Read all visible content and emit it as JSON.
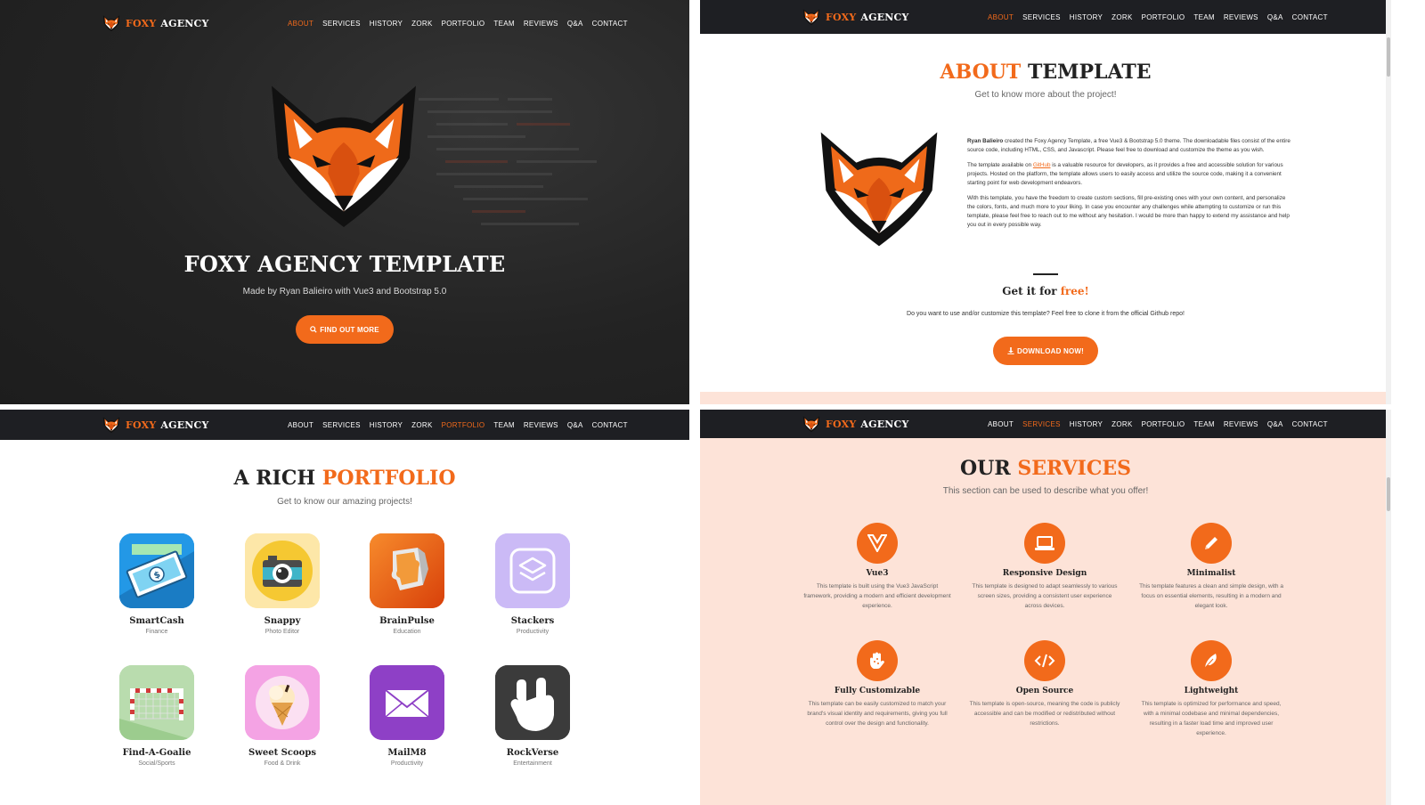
{
  "brand": {
    "part1": "FOXY",
    "part2": "AGENCY"
  },
  "nav": [
    "ABOUT",
    "SERVICES",
    "HISTORY",
    "ZORK",
    "PORTFOLIO",
    "TEAM",
    "REVIEWS",
    "Q&A",
    "CONTACT"
  ],
  "colors": {
    "accent": "#f26a1b",
    "dark": "#1e1f23",
    "peach": "#fde3d8"
  },
  "hero": {
    "title": "FOXY AGENCY TEMPLATE",
    "subtitle": "Made by Ryan Balieiro with Vue3 and Bootstrap 5.0",
    "button": "FIND OUT MORE",
    "button_icon": "search-icon"
  },
  "about": {
    "title_hl": "ABOUT",
    "title_rest": "TEMPLATE",
    "subtitle": "Get to know more about the project!",
    "p1_author": "Ryan Balieiro",
    "p1_rest": "created the Foxy Agency Template, a free Vue3 & Bootstrap 5.0 theme. The downloadable files consist of the entire source code, including HTML, CSS, and Javascript. Please feel free to download and customize the theme as you wish.",
    "p2_pre": "The template available on",
    "p2_link": "GitHub",
    "p2_post": "is a valuable resource for developers, as it provides a free and accessible solution for various projects. Hosted on the platform, the template allows users to easily access and utilize the source code, making it a convenient starting point for web development endeavors.",
    "p3": "With this template, you have the freedom to create custom sections, fill pre-existing ones with your own content, and personalize the colors, fonts, and much more to your liking. In case you encounter any challenges while attempting to customize or run this template, please feel free to reach out to me without any hesitation. I would be more than happy to extend my assistance and help you out in every possible way.",
    "free_title": "Get it for",
    "free_hl": "free!",
    "free_sub": "Do you want to use and/or customize this template? Feel free to clone it from the official Github repo!",
    "button": "DOWNLOAD NOW!",
    "button_icon": "download-icon"
  },
  "portfolio": {
    "title_rest": "A RICH",
    "title_hl": "PORTFOLIO",
    "subtitle": "Get to know our amazing projects!",
    "items": [
      {
        "name": "SmartCash",
        "category": "Finance",
        "icon": "money-icon",
        "bg": "#1e8fe0"
      },
      {
        "name": "Snappy",
        "category": "Photo Editor",
        "icon": "camera-icon",
        "bg": "#fde7a8"
      },
      {
        "name": "BrainPulse",
        "category": "Education",
        "icon": "puzzle-icon",
        "bg": "#ee5a12"
      },
      {
        "name": "Stackers",
        "category": "Productivity",
        "icon": "stack-icon",
        "bg": "#c9b8f5"
      },
      {
        "name": "Find-A-Goalie",
        "category": "Social/Sports",
        "icon": "goal-icon",
        "bg": "#b5dbab"
      },
      {
        "name": "Sweet Scoops",
        "category": "Food & Drink",
        "icon": "ice-cream-icon",
        "bg": "#f6a6e6"
      },
      {
        "name": "MailM8",
        "category": "Productivity",
        "icon": "mail-icon",
        "bg": "#8d3fc4"
      },
      {
        "name": "RockVerse",
        "category": "Entertainment",
        "icon": "rock-hand-icon",
        "bg": "#3a3a3a"
      }
    ]
  },
  "services": {
    "title_rest": "OUR",
    "title_hl": "SERVICES",
    "subtitle": "This section can be used to describe what you offer!",
    "items": [
      {
        "name": "Vue3",
        "icon": "vue-icon",
        "desc": "This template is built using the Vue3 JavaScript framework, providing a modern and efficient development experience."
      },
      {
        "name": "Responsive Design",
        "icon": "laptop-icon",
        "desc": "This template is designed to adapt seamlessly to various screen sizes, providing a consistent user experience across devices."
      },
      {
        "name": "Minimalist",
        "icon": "pencil-icon",
        "desc": "This template features a clean and simple design, with a focus on essential elements, resulting in a modern and elegant look."
      },
      {
        "name": "Fully Customizable",
        "icon": "hand-sparkles-icon",
        "desc": "This template can be easily customized to match your brand's visual identity and requirements, giving you full control over the design and functionality."
      },
      {
        "name": "Open Source",
        "icon": "code-icon",
        "desc": "This template is open-source, meaning the code is publicly accessible and can be modified or redistributed without restrictions."
      },
      {
        "name": "Lightweight",
        "icon": "feather-icon",
        "desc": "This template is optimized for performance and speed, with a minimal codebase and minimal dependencies, resulting in a faster load time and improved user experience."
      }
    ]
  }
}
